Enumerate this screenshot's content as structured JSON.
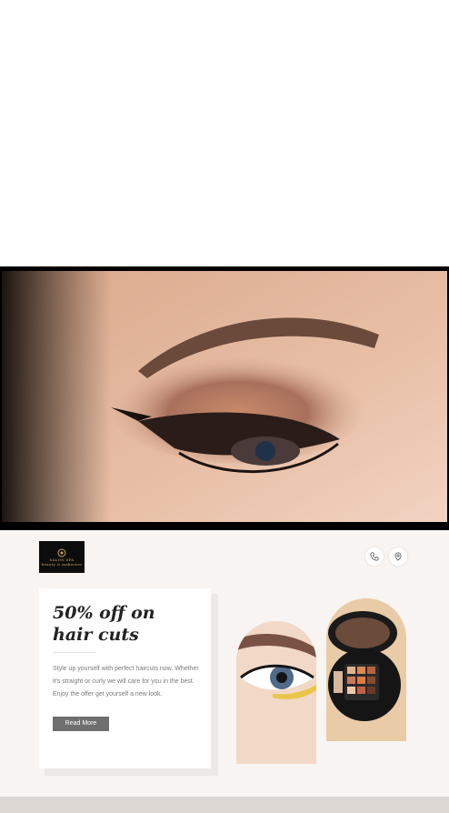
{
  "brand": {
    "logo_text_line1": "SALON SPA",
    "logo_text_line2": "beauty & makeover",
    "accent_color": "#caa65a"
  },
  "header_icons": {
    "phone": "phone-icon",
    "location": "location-pin-icon"
  },
  "promo": {
    "title": "50% off on hair cuts",
    "description": "Style up yourself with perfect haircuts now. Whether it's straight or curly we will care for you in the best. Enjoy the offer get yourself a new look.",
    "button_label": "Read More"
  },
  "images": {
    "hero": "eye-makeup-closeup",
    "gallery": [
      "eye-with-eyeliner",
      "makeup-palette"
    ]
  }
}
